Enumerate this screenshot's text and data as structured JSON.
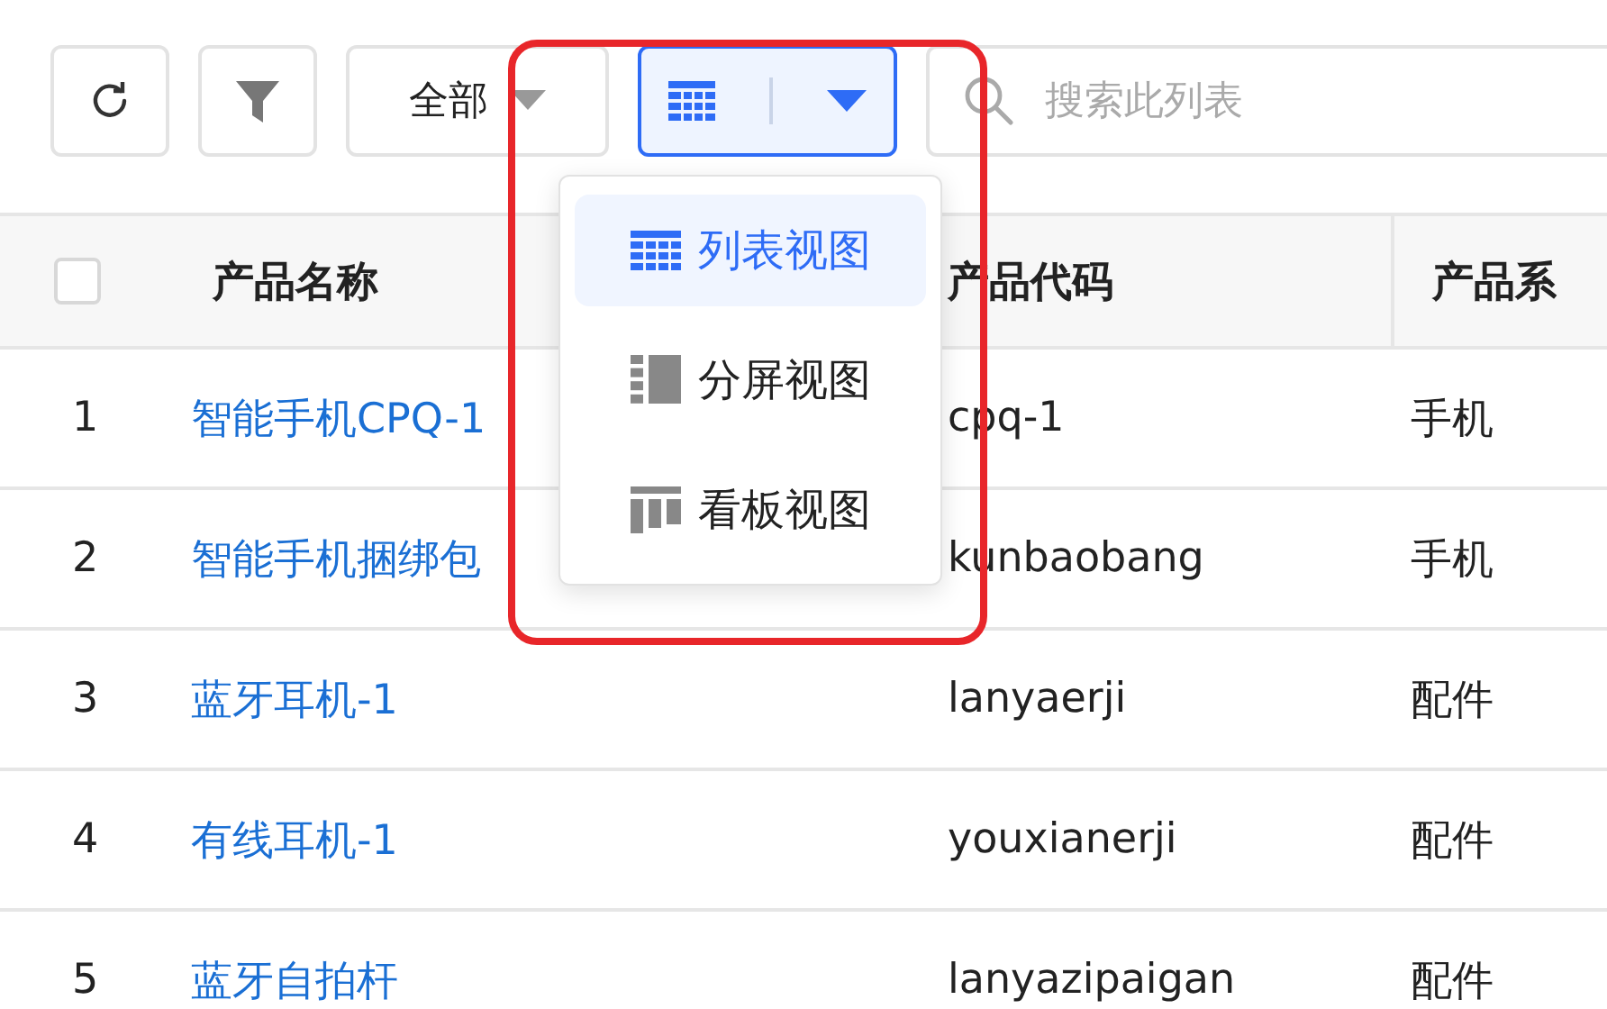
{
  "toolbar": {
    "filter_select": "全部",
    "search": {
      "placeholder": "搜索此列表"
    }
  },
  "view_menu": [
    {
      "label": "列表视图",
      "kind": "list",
      "selected": true
    },
    {
      "label": "分屏视图",
      "kind": "split",
      "selected": false
    },
    {
      "label": "看板视图",
      "kind": "board",
      "selected": false
    }
  ],
  "table": {
    "header_checked": false,
    "columns": [
      "产品名称",
      "产品代码",
      "产品系"
    ],
    "rows": [
      {
        "index": "1",
        "name": "智能手机CPQ-1",
        "code": "cpq-1",
        "series": "手机"
      },
      {
        "index": "2",
        "name": "智能手机捆绑包",
        "code": "kunbaobang",
        "series": "手机"
      },
      {
        "index": "3",
        "name": "蓝牙耳机-1",
        "code": "lanyaerji",
        "series": "配件"
      },
      {
        "index": "4",
        "name": "有线耳机-1",
        "code": "youxianerji",
        "series": "配件"
      },
      {
        "index": "5",
        "name": "蓝牙自拍杆",
        "code": "lanyazipaigan",
        "series": "配件"
      }
    ]
  }
}
